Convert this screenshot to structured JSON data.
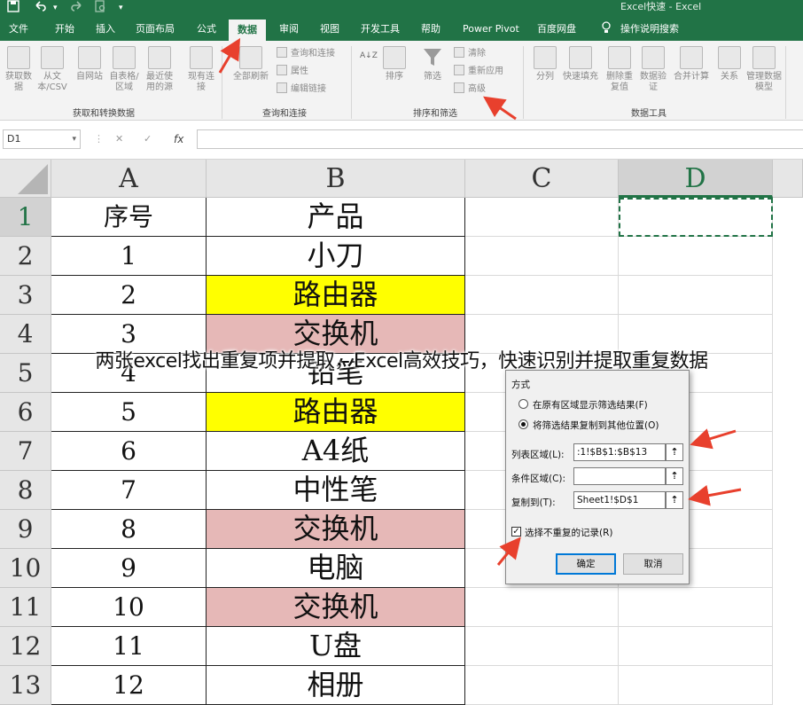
{
  "titlebar": {
    "title": "Excel快速 - Excel",
    "save_icon": "save-icon",
    "undo_icon": "undo-icon",
    "redo_icon": "redo-icon",
    "more_icon": "customize-toolbar-icon"
  },
  "tabs": [
    {
      "label": "文件"
    },
    {
      "label": "开始"
    },
    {
      "label": "插入"
    },
    {
      "label": "页面布局"
    },
    {
      "label": "公式"
    },
    {
      "label": "数据",
      "active": true
    },
    {
      "label": "审阅"
    },
    {
      "label": "视图"
    },
    {
      "label": "开发工具"
    },
    {
      "label": "帮助"
    },
    {
      "label": "Power Pivot"
    },
    {
      "label": "百度网盘"
    },
    {
      "label": "操作说明搜索"
    }
  ],
  "ribbon": {
    "get_data": {
      "group_label": "获取和转换数据",
      "buttons": [
        {
          "label": "获取数据",
          "extra": "据"
        },
        {
          "label": "从文本/CSV"
        },
        {
          "label": "自网站"
        },
        {
          "label": "自表格/区域"
        },
        {
          "label": "最近使用的源"
        },
        {
          "label": "现有连接"
        }
      ]
    },
    "queries": {
      "group_label": "查询和连接",
      "refresh_all": "全部刷新",
      "items": [
        "查询和连接",
        "属性",
        "编辑链接"
      ]
    },
    "sort_filter": {
      "group_label": "排序和筛选",
      "sort_az": "A↓Z",
      "sort": "排序",
      "filter": "筛选",
      "clear": "清除",
      "reapply": "重新应用",
      "advanced": "高级"
    },
    "data_tools": {
      "group_label": "数据工具",
      "buttons": [
        "分列",
        "快速填充",
        "删除重复值",
        "数据验证",
        "合并计算",
        "关系",
        "管理数据模型"
      ]
    }
  },
  "formula_bar": {
    "name_box": "D1",
    "cancel": "✕",
    "enter": "✓",
    "fx": "fx",
    "value": ""
  },
  "grid": {
    "columns": [
      "A",
      "B",
      "C",
      "D"
    ],
    "selected_column": "D",
    "selected_row": "1",
    "rows": [
      {
        "num": "1",
        "a": "序号",
        "b": "产品",
        "fill": ""
      },
      {
        "num": "2",
        "a": "1",
        "b": "小刀",
        "fill": ""
      },
      {
        "num": "3",
        "a": "2",
        "b": "路由器",
        "fill": "#ffff00"
      },
      {
        "num": "4",
        "a": "3",
        "b": "交换机",
        "fill": "#e6b8b7"
      },
      {
        "num": "5",
        "a": "4",
        "b": "铅笔",
        "fill": ""
      },
      {
        "num": "6",
        "a": "5",
        "b": "路由器",
        "fill": "#ffff00"
      },
      {
        "num": "7",
        "a": "6",
        "b": "A4纸",
        "fill": ""
      },
      {
        "num": "8",
        "a": "7",
        "b": "中性笔",
        "fill": ""
      },
      {
        "num": "9",
        "a": "8",
        "b": "交换机",
        "fill": "#e6b8b7"
      },
      {
        "num": "10",
        "a": "9",
        "b": "电脑",
        "fill": ""
      },
      {
        "num": "11",
        "a": "10",
        "b": "交换机",
        "fill": "#e6b8b7"
      },
      {
        "num": "12",
        "a": "11",
        "b": "U盘",
        "fill": ""
      },
      {
        "num": "13",
        "a": "12",
        "b": "相册",
        "fill": ""
      }
    ]
  },
  "caption": "两张excel找出重复项并提取，Excel高效技巧，快速识别并提取重复数据",
  "dialog": {
    "section": "方式",
    "option_inplace": "在原有区域显示筛选结果(F)",
    "option_copy": "将筛选结果复制到其他位置(O)",
    "list_range_label": "列表区域(L):",
    "list_range_value": ":1!$B$1:$B$13",
    "criteria_label": "条件区域(C):",
    "criteria_value": "",
    "copy_to_label": "复制到(T):",
    "copy_to_value": "Sheet1!$D$1",
    "unique_label": "选择不重复的记录(R)",
    "unique_checked": true,
    "ok": "确定",
    "cancel": "取消"
  },
  "colors": {
    "excel_green": "#217346",
    "yellow_fill": "#ffff00",
    "pink_fill": "#e6b8b7",
    "annotation_arrow": "#e8402d"
  }
}
